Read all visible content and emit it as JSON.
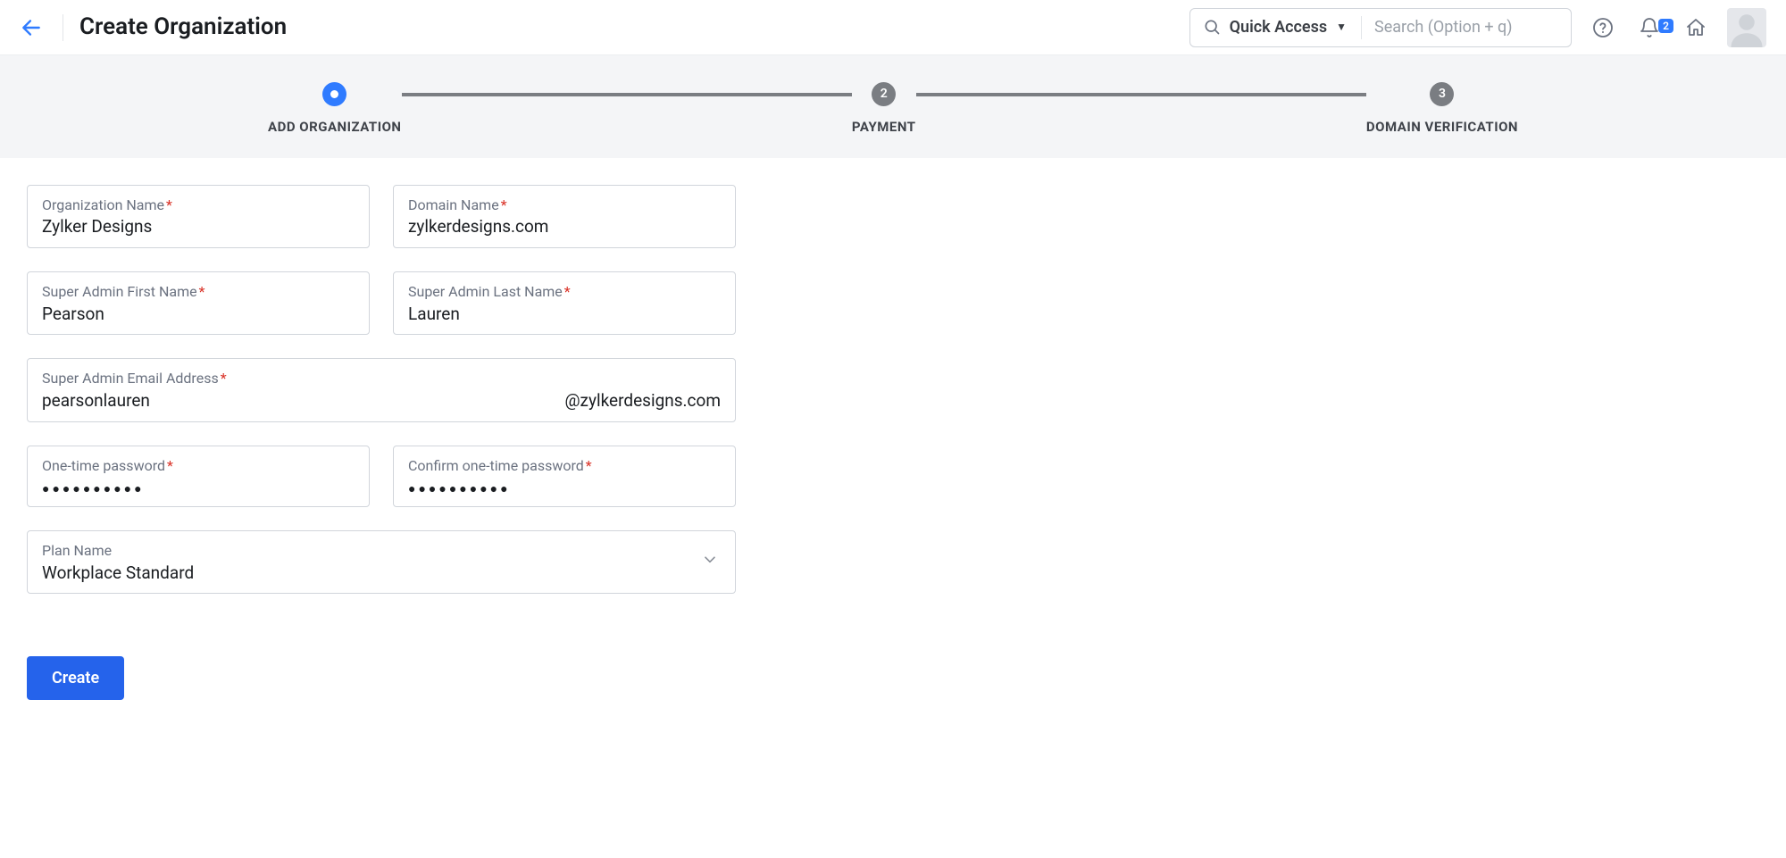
{
  "header": {
    "page_title": "Create Organization",
    "quick_access_label": "Quick Access",
    "search_placeholder": "Search (Option + q)",
    "notification_count": "2"
  },
  "stepper": {
    "steps": [
      {
        "label": "ADD ORGANIZATION",
        "num": "",
        "active": true
      },
      {
        "label": "PAYMENT",
        "num": "2",
        "active": false
      },
      {
        "label": "DOMAIN VERIFICATION",
        "num": "3",
        "active": false
      }
    ]
  },
  "form": {
    "org_name_label": "Organization Name",
    "org_name_value": "Zylker Designs",
    "domain_label": "Domain Name",
    "domain_value": "zylkerdesigns.com",
    "first_name_label": "Super Admin First Name",
    "first_name_value": "Pearson",
    "last_name_label": "Super Admin Last Name",
    "last_name_value": "Lauren",
    "email_label": "Super Admin Email Address",
    "email_local": "pearsonlauren",
    "email_domain": "@zylkerdesigns.com",
    "otp_label": "One-time password",
    "otp_value": "●●●●●●●●●●",
    "confirm_otp_label": "Confirm one-time password",
    "confirm_otp_value": "●●●●●●●●●●",
    "plan_label": "Plan Name",
    "plan_value": "Workplace Standard",
    "create_label": "Create"
  }
}
